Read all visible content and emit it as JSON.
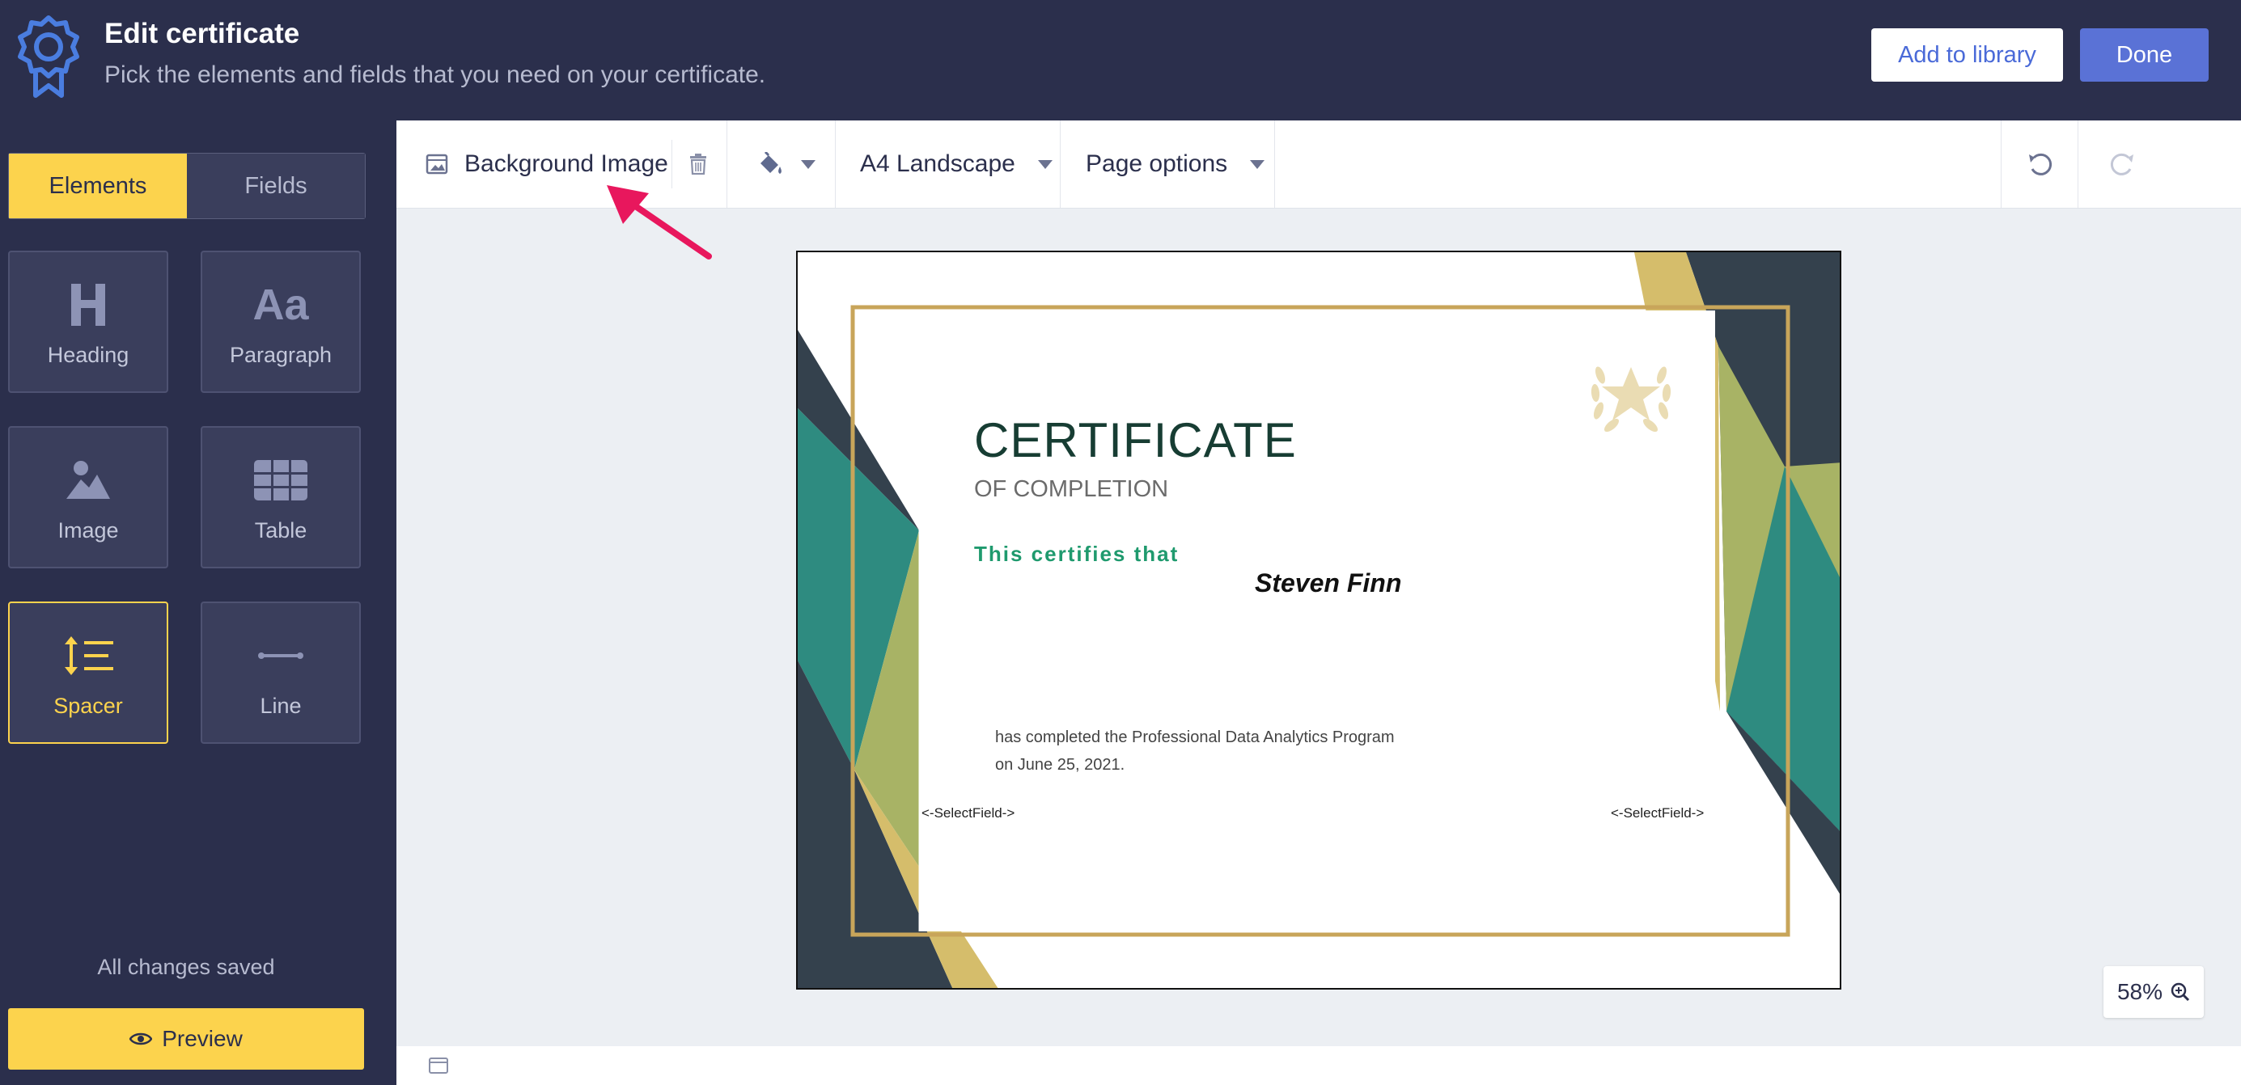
{
  "header": {
    "title": "Edit certificate",
    "subtitle": "Pick the elements and fields that you need on your certificate.",
    "add_to_library": "Add to library",
    "done": "Done"
  },
  "sidebar": {
    "tabs": [
      {
        "label": "Elements",
        "active": true
      },
      {
        "label": "Fields",
        "active": false
      }
    ],
    "elements": [
      {
        "label": "Heading",
        "icon": "heading-icon"
      },
      {
        "label": "Paragraph",
        "icon": "paragraph-icon"
      },
      {
        "label": "Image",
        "icon": "image-icon"
      },
      {
        "label": "Table",
        "icon": "table-icon"
      },
      {
        "label": "Spacer",
        "icon": "spacer-icon",
        "active": true
      },
      {
        "label": "Line",
        "icon": "line-icon"
      }
    ],
    "status": "All changes saved",
    "preview": "Preview"
  },
  "toolbar": {
    "background_image": "Background Image",
    "page_size": "A4 Landscape",
    "page_options": "Page options"
  },
  "certificate": {
    "title": "CERTIFICATE",
    "subtitle": "OF COMPLETION",
    "certifies": "This certifies that",
    "name": "Steven Finn",
    "body_line1": "has completed the Professional Data Analytics Program",
    "body_line2": "on June 25, 2021.",
    "select_field_left": "<-SelectField->",
    "select_field_right": "<-SelectField->"
  },
  "zoom": {
    "level": "58%"
  },
  "colors": {
    "header_bg": "#2b2f4c",
    "accent_yellow": "#fcd34d",
    "done_blue": "#5a72d6",
    "cert_teal": "#2e8b80",
    "cert_gold": "#c8a55a",
    "cert_navy": "#34414d",
    "annotation_arrow": "#e8175d"
  }
}
